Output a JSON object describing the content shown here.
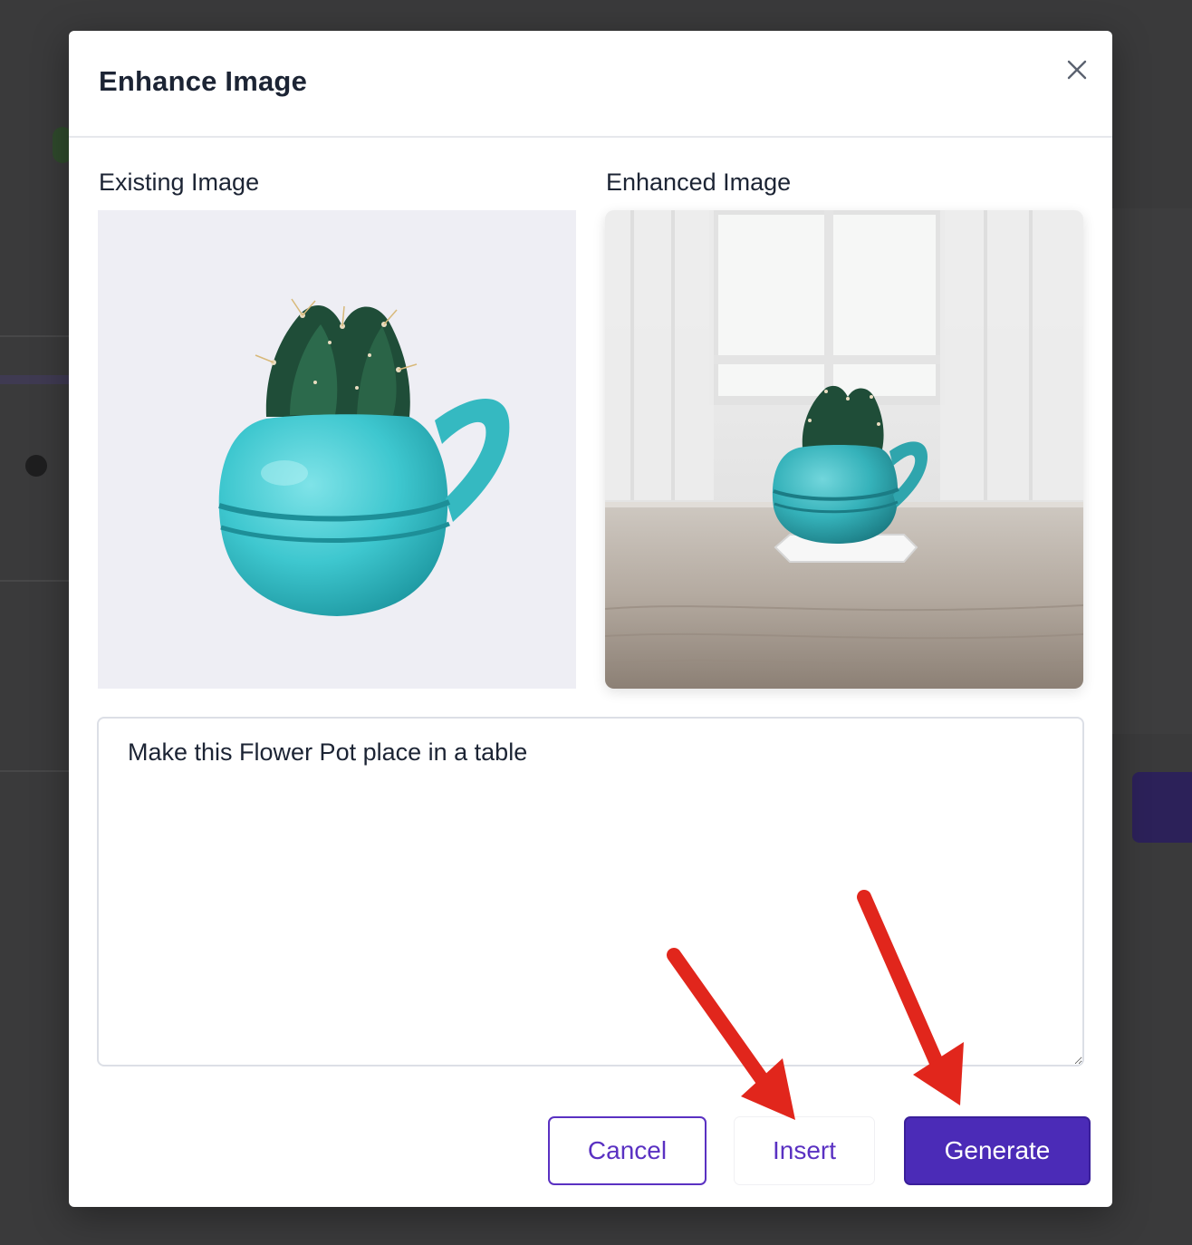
{
  "modal": {
    "title": "Enhance Image",
    "close_icon": "close-icon"
  },
  "existing": {
    "label": "Existing Image"
  },
  "enhanced": {
    "label": "Enhanced Image"
  },
  "prompt": {
    "value": "Make this Flower Pot place in a table"
  },
  "actions": {
    "cancel_label": "Cancel",
    "insert_label": "Insert",
    "generate_label": "Generate"
  },
  "colors": {
    "accent": "#4b2bb7",
    "accent_text": "#5a31c2",
    "title_text": "#1c2434",
    "pot": "#3ec7cf",
    "annotation_arrow": "#e1261c"
  }
}
